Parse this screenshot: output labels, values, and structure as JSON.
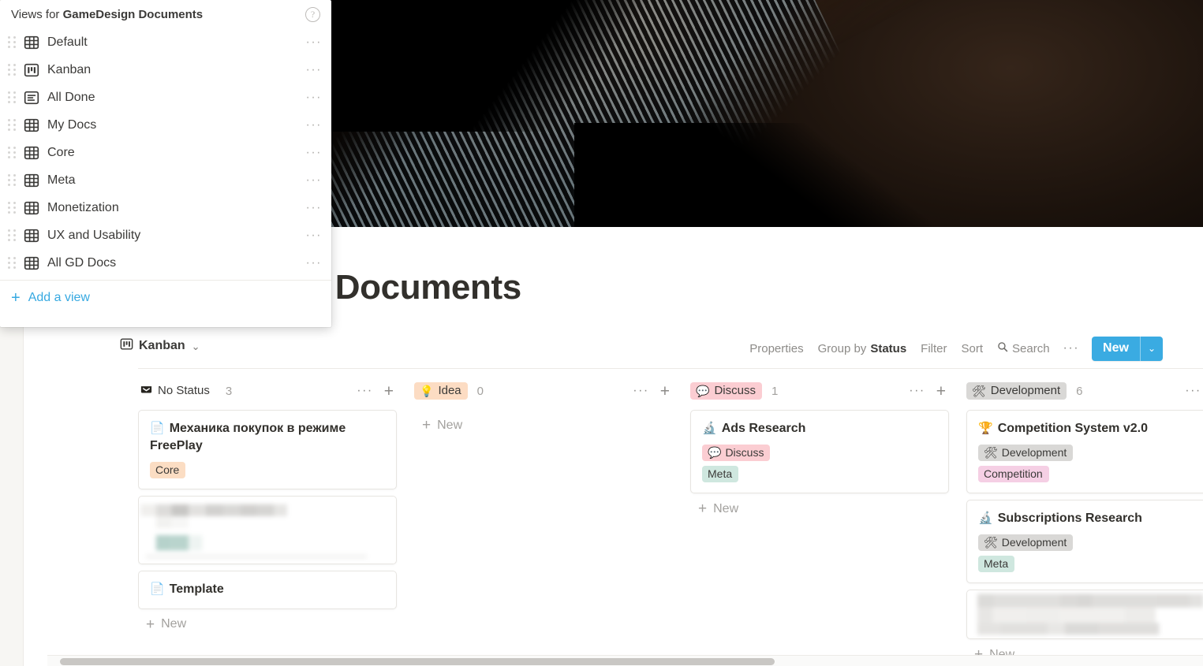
{
  "page": {
    "title": "GameDesign Documents",
    "title_visible_fragment": "sign Documents",
    "cover_alt": "dark abstract cover photo"
  },
  "views_popup": {
    "header_prefix": "Views for ",
    "header_target": "GameDesign Documents",
    "help_icon": "help-circle-icon",
    "items": [
      {
        "label": "Default",
        "icon": "table-view-icon",
        "dots": "···"
      },
      {
        "label": "Kanban",
        "icon": "board-view-icon",
        "dots": "···"
      },
      {
        "label": "All Done",
        "icon": "list-view-icon",
        "dots": "···"
      },
      {
        "label": "My Docs",
        "icon": "table-view-icon",
        "dots": "···"
      },
      {
        "label": "Core",
        "icon": "table-view-icon",
        "dots": "···"
      },
      {
        "label": "Meta",
        "icon": "table-view-icon",
        "dots": "···"
      },
      {
        "label": "Monetization",
        "icon": "table-view-icon",
        "dots": "···"
      },
      {
        "label": "UX and Usability",
        "icon": "table-view-icon",
        "dots": "···"
      },
      {
        "label": "All GD Docs",
        "icon": "table-view-icon",
        "dots": "···"
      }
    ],
    "add_view_label": "Add a view",
    "add_view_plus": "+",
    "accent": "#37a9e1"
  },
  "view_bar": {
    "current_view": "Kanban",
    "current_view_icon": "board-view-icon",
    "chevron": "⌄",
    "toolbar": {
      "properties": "Properties",
      "group_by_prefix": "Group by ",
      "group_by_value": "Status",
      "filter": "Filter",
      "sort": "Sort",
      "search": "Search",
      "search_icon": "search-icon",
      "more_dots": "···",
      "new_label": "New",
      "new_arrow": "⌄",
      "new_color": "#3aabe2"
    }
  },
  "board": {
    "add_new_label": "New",
    "add_new_plus": "+",
    "col_dots": "···",
    "col_plus": "+",
    "columns": [
      {
        "status": "No Status",
        "status_icon": "inbox-icon",
        "status_bg": "transparent",
        "count": "3",
        "cards": [
          {
            "title": "Механика покупок в режиме FreePlay",
            "icon": "📄",
            "icon_name": "document-icon",
            "tags": [
              {
                "label": "Core",
                "bg": "#fbddc3",
                "emoji": ""
              }
            ],
            "redacted": false
          },
          {
            "title": "",
            "icon": "",
            "icon_name": "",
            "tags": [],
            "redacted": true
          },
          {
            "title": "Template",
            "icon": "📄",
            "icon_name": "document-icon",
            "tags": [],
            "redacted": false
          }
        ]
      },
      {
        "status": "Idea",
        "status_icon": "lightbulb-icon",
        "status_emoji": "💡",
        "status_bg": "#fcdcc3",
        "count": "0",
        "cards": []
      },
      {
        "status": "Discuss",
        "status_icon": "speech-bubble-icon",
        "status_emoji": "💬",
        "status_bg": "#fbcdd2",
        "count": "1",
        "cards": [
          {
            "title": "Ads Research",
            "icon": "🔬",
            "icon_name": "microscope-icon",
            "tags": [
              {
                "label": "Discuss",
                "bg": "#fbcdd2",
                "emoji": "💬"
              },
              {
                "label": "Meta",
                "bg": "#cfe7df",
                "emoji": ""
              }
            ],
            "redacted": false
          }
        ]
      },
      {
        "status": "Development",
        "status_icon": "hammer-and-wrench-icon",
        "status_emoji": "🛠",
        "status_bg": "#d9d8d6",
        "count": "6",
        "cards": [
          {
            "title": "Competition System v2.0",
            "icon": "🏆",
            "icon_name": "trophy-icon",
            "tags": [
              {
                "label": "Development",
                "bg": "#d9d8d6",
                "emoji": "🛠"
              },
              {
                "label": "Competition",
                "bg": "#f5cfe4",
                "emoji": ""
              }
            ],
            "redacted": false
          },
          {
            "title": "Subscriptions Research",
            "icon": "🔬",
            "icon_name": "microscope-icon",
            "tags": [
              {
                "label": "Development",
                "bg": "#d9d8d6",
                "emoji": "🛠"
              },
              {
                "label": "Meta",
                "bg": "#cfe7df",
                "emoji": ""
              }
            ],
            "redacted": false
          },
          {
            "title": "",
            "icon": "",
            "icon_name": "",
            "tags": [],
            "redacted": true
          }
        ]
      }
    ]
  },
  "scrollbar": {
    "name": "horizontal-scrollbar"
  }
}
